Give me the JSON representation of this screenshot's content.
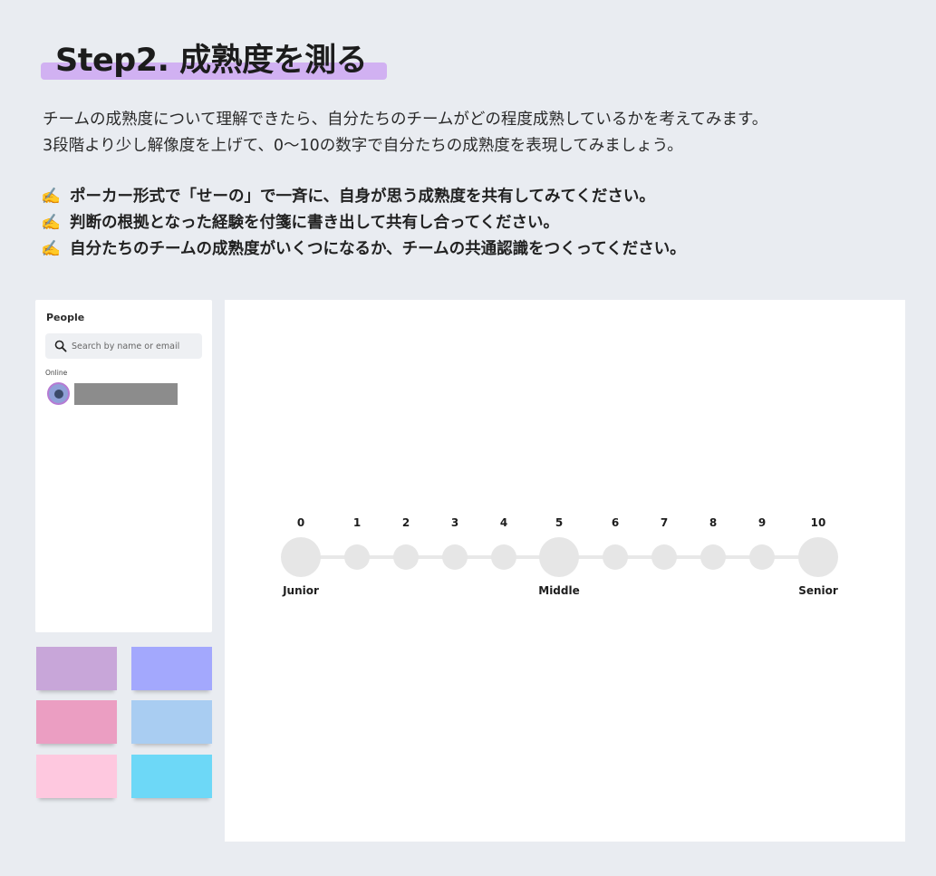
{
  "header": {
    "title": "Step2. 成熟度を測る",
    "intro_lines": [
      "チームの成熟度について理解できたら、自分たちのチームがどの程度成熟しているかを考えてみます。",
      "3段階より少し解像度を上げて、0〜10の数字で自分たちの成熟度を表現してみましょう。"
    ],
    "bullet_emoji": "✍️",
    "bullets": [
      "ポーカー形式で「せーの」で一斉に、自身が思う成熟度を共有してみてください。",
      "判断の根拠となった経験を付箋に書き出して共有し合ってください。",
      "自分たちのチームの成熟度がいくつになるか、チームの共通認識をつくってください。"
    ],
    "highlight_color": "#d1b1f2"
  },
  "people_panel": {
    "title": "People",
    "search_placeholder": "Search by name or email",
    "online_label": "Online",
    "icons": [
      "search-icon",
      "avatar"
    ]
  },
  "sticky_notes": {
    "colors": [
      "#c8a6d9",
      "#a3a8fd",
      "#eb9ec2",
      "#a9cdf2",
      "#fec8df",
      "#6dd8f7"
    ]
  },
  "maturity_scale": {
    "numbers": [
      "0",
      "1",
      "2",
      "3",
      "4",
      "5",
      "6",
      "7",
      "8",
      "9",
      "10"
    ],
    "levels": [
      {
        "label": "Junior",
        "at": 0
      },
      {
        "label": "Middle",
        "at": 5
      },
      {
        "label": "Senior",
        "at": 10
      }
    ],
    "node_color": "#e6e6e6"
  }
}
